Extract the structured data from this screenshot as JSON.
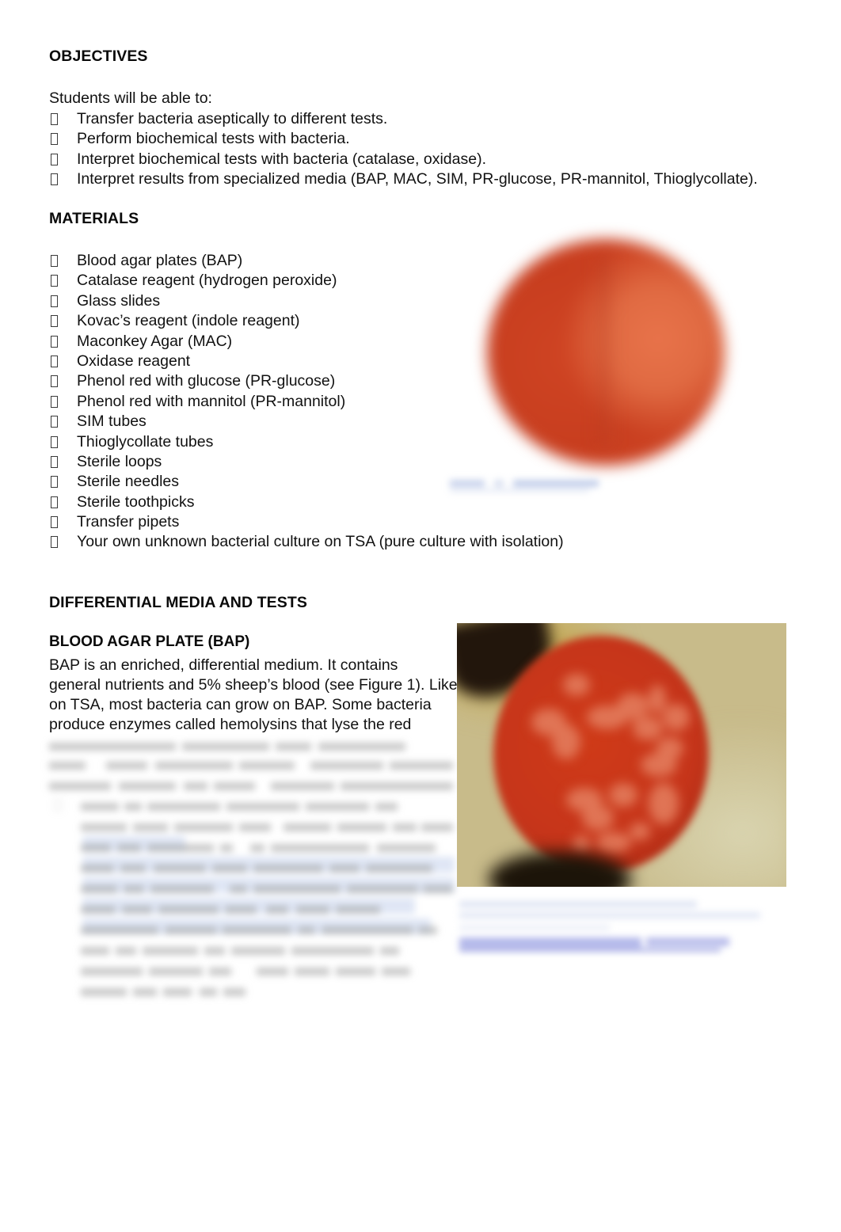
{
  "document": {
    "background_color": "#ffffff",
    "text_color": "#111111",
    "link_color": "#4b5fc8"
  },
  "objectives": {
    "heading": "OBJECTIVES",
    "intro": "Students will be able to:",
    "bullet_glyph": "missing-glyph-box",
    "items": [
      "Transfer bacteria aseptically to different tests.",
      "Perform biochemical tests with bacteria.",
      "Interpret biochemical tests with bacteria (catalase, oxidase).",
      "Interpret results from specialized media (BAP, MAC, SIM, PR-glucose, PR-mannitol, Thioglycollate)."
    ]
  },
  "materials": {
    "heading": "MATERIALS",
    "items": [
      "Blood agar plates (BAP)",
      "Catalase reagent (hydrogen peroxide)",
      "Glass slides",
      "Kovac’s reagent (indole reagent)",
      "Maconkey Agar (MAC)",
      "Oxidase reagent",
      "Phenol red with glucose (PR-glucose)",
      "Phenol red with mannitol (PR-mannitol)",
      "SIM tubes",
      "Thioglycollate tubes",
      "Sterile loops",
      "Sterile needles",
      "Sterile toothpicks",
      "Transfer pipets",
      "Your own unknown bacterial culture on TSA (pure culture with isolation)"
    ]
  },
  "differential": {
    "heading": "DIFFERENTIAL MEDIA AND TESTS",
    "bap": {
      "subheading": "BLOOD AGAR PLATE (BAP)",
      "paragraph_lines": [
        "BAP is an enriched, differential medium. It contains",
        "general nutrients and 5% sheep’s blood (see Figure 1). Like",
        "on TSA, most bacteria can grow on BAP. Some bacteria",
        "produce enzymes called hemolysins that lyse the red"
      ]
    },
    "obscured_block": {
      "state": "blurred-unreadable",
      "line_count": 14
    }
  },
  "figures": [
    {
      "name": "agar-plate-top-right",
      "alt": "Blurred round red-orange agar plate",
      "caption": {
        "state": "blurred-unreadable",
        "color": "#c5cfe8"
      }
    },
    {
      "name": "blood-agar-plate-photo",
      "alt": "Blurred photograph of a blood agar plate with red colonies on a tan background",
      "caption": {
        "state": "blurred-unreadable",
        "color": "#b0b6e6"
      }
    }
  ]
}
